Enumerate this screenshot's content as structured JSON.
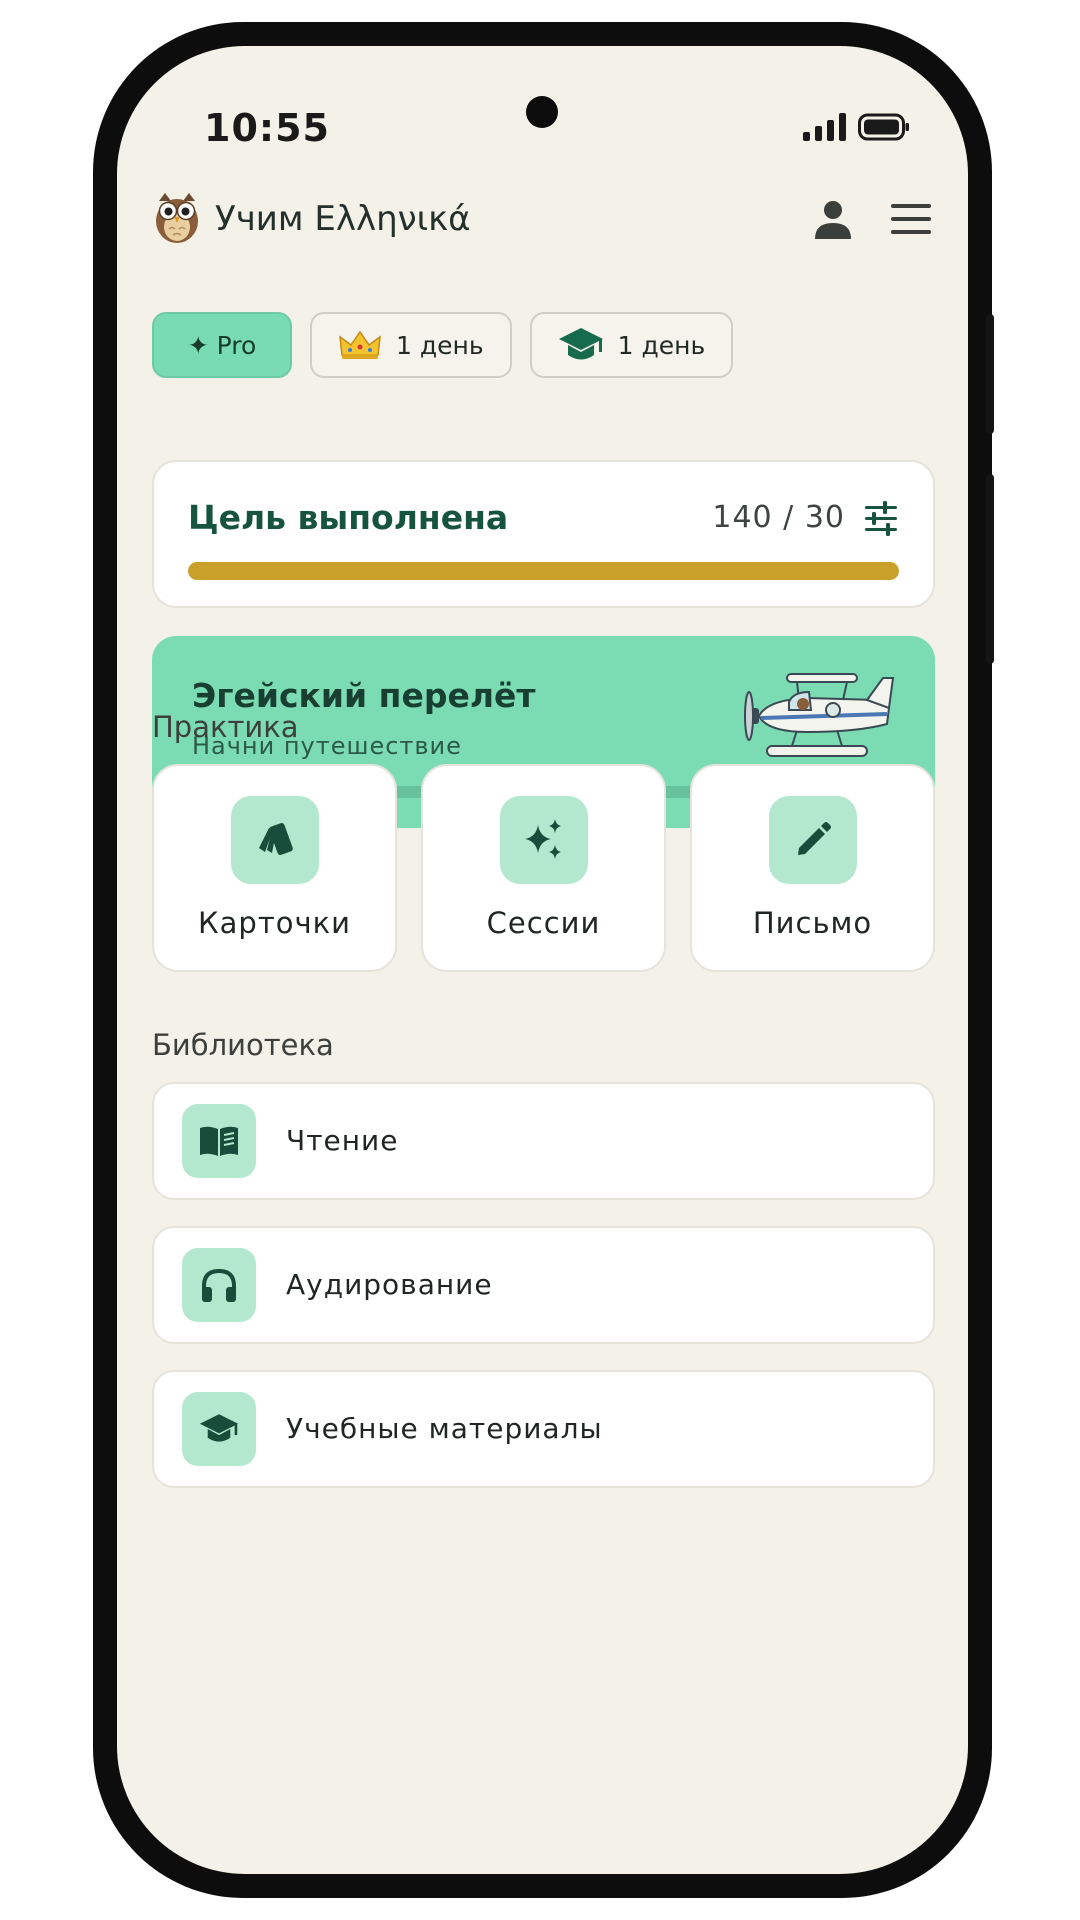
{
  "status_bar": {
    "time": "10:55"
  },
  "header": {
    "app_title": "Учим Ελληνικά"
  },
  "chips": [
    {
      "label": "✦ Pro"
    },
    {
      "label": "1 день",
      "icon": "crown-icon"
    },
    {
      "label": "1 день",
      "icon": "graduation-cap-icon"
    }
  ],
  "goal": {
    "title": "Цель выполнена",
    "count": "140 / 30",
    "progress": 1.0
  },
  "journey": {
    "title": "Эгейский перелёт",
    "subtitle": "Начни путешествие",
    "progress": 0.0
  },
  "practice": {
    "section_label": "Практика",
    "tiles": [
      {
        "label": "Карточки",
        "icon": "flashcards-icon"
      },
      {
        "label": "Сессии",
        "icon": "sparkles-icon"
      },
      {
        "label": "Письмо",
        "icon": "pencil-icon"
      }
    ]
  },
  "library": {
    "section_label": "Библиотека",
    "items": [
      {
        "label": "Чтение",
        "icon": "book-icon"
      },
      {
        "label": "Аудирование",
        "icon": "headphones-icon"
      },
      {
        "label": "Учебные материалы",
        "icon": "graduation-cap-icon"
      }
    ]
  },
  "colors": {
    "background": "#f4f1e9",
    "accent": "#79dbb3",
    "accent_dark": "#17543f",
    "goal_bar": "#c8a02a",
    "icon_tile": "#b3e8cf"
  }
}
